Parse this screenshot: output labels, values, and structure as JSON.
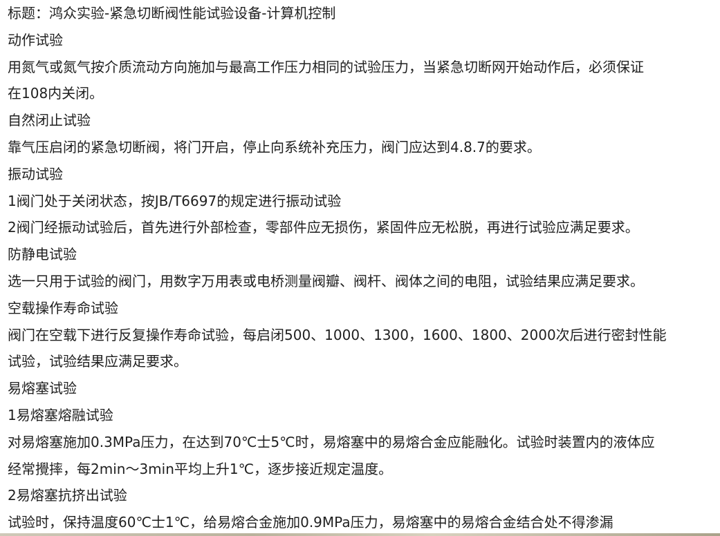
{
  "lines": [
    "标题：鸿众实验-紧急切断阀性能试验设备-计算机控制",
    "动作试验",
    "用氮气或氮气按介质流动方向施加与最高工作压力相同的试验压力，当紧急切断网开始动作后，必须保证",
    "在108内关闭。",
    "自然闭止试验",
    "靠气压启闭的紧急切断阀，将门开启，停止向系统补充压力，阀门应达到4.8.7的要求。",
    "振动试验",
    "1阀门处于关闭状态，按JB/T6697的规定进行振动试验",
    "2阀门经振动试验后，首先进行外部检查，零部件应无损伤，紧固件应无松脱，再进行试验应满足要求。",
    "防静电试验",
    "选一只用于试验的阀门，用数字万用表或电桥测量阀瓣、阀杆、阀体之间的电阻，试验结果应满足要求。",
    "空载操作寿命试验",
    "阀门在空载下进行反复操作寿命试验，每启闭500、1000、1300，1600、1800、2000次后进行密封性能",
    "试验，试验结果应满足要求。",
    "易熔塞试验",
    "1易熔塞熔融试验",
    "对易熔塞施加0.3MPa压力，在达到70℃士5℃时，易熔塞中的易熔合金应能融化。试验时装置内的液体应",
    "经常攪摔，每2min～3min平均上升1℃，逐步接近规定温度。",
    "2易熔塞抗挤出试验",
    "试验时，保持温度60℃士1℃，给易熔合金施加0.9MPa压力，易熔塞中的易熔合金结合处不得渗漏"
  ]
}
